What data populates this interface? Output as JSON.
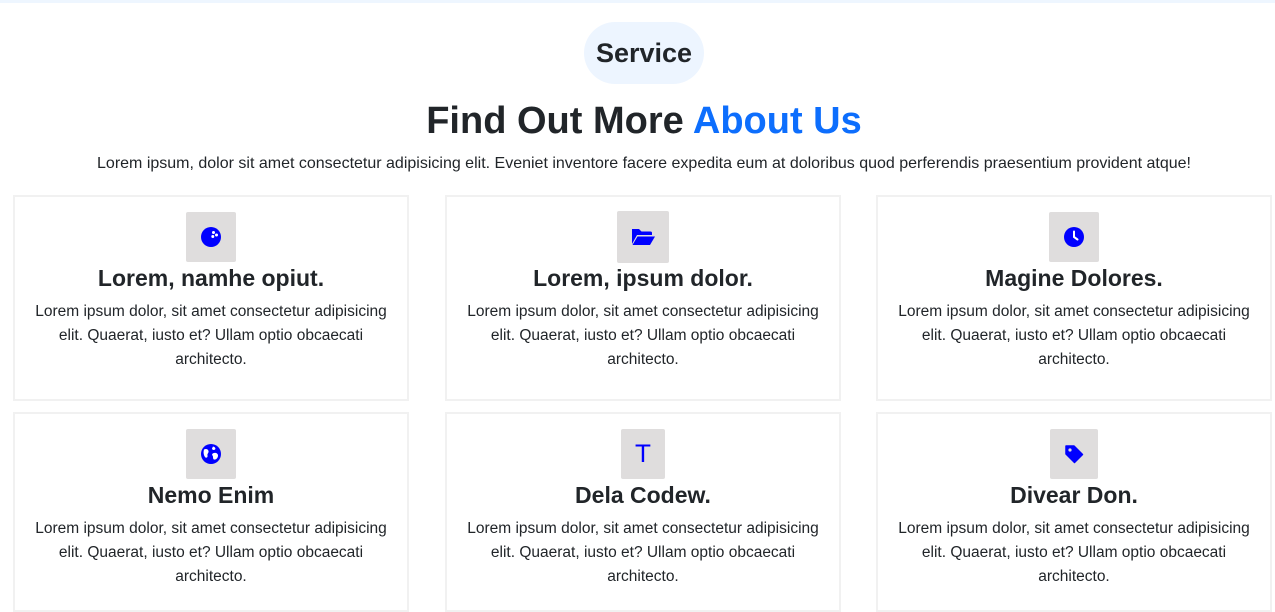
{
  "section": {
    "badge": "Service",
    "heading_main": "Find Out More ",
    "heading_accent": "About Us",
    "subtitle": "Lorem ipsum, dolor sit amet consectetur adipisicing elit. Eveniet inventore facere expedita eum at doloribus quod perferendis praesentium provident atque!"
  },
  "colors": {
    "accent": "#0d6efd",
    "icon": "#0000ff",
    "icon_bg": "#dfdddd",
    "badge_bg": "#edf5ff"
  },
  "cards": [
    {
      "icon": "bowling-ball-icon",
      "title": "Lorem, namhe opiut.",
      "text": "Lorem ipsum dolor, sit amet consectetur adipisicing elit. Quaerat, iusto et? Ullam optio obcaecati architecto."
    },
    {
      "icon": "folder-open-icon",
      "title": "Lorem, ipsum dolor.",
      "text": "Lorem ipsum dolor, sit amet consectetur adipisicing elit. Quaerat, iusto et? Ullam optio obcaecati architecto."
    },
    {
      "icon": "clock-icon",
      "title": "Magine Dolores.",
      "text": "Lorem ipsum dolor, sit amet consectetur adipisicing elit. Quaerat, iusto et? Ullam optio obcaecati architecto."
    },
    {
      "icon": "globe-icon",
      "title": "Nemo Enim",
      "text": "Lorem ipsum dolor, sit amet consectetur adipisicing elit. Quaerat, iusto et? Ullam optio obcaecati architecto."
    },
    {
      "icon": "letter-t-icon",
      "icon_text": "T",
      "title": "Dela Codew.",
      "text": "Lorem ipsum dolor, sit amet consectetur adipisicing elit. Quaerat, iusto et? Ullam optio obcaecati architecto."
    },
    {
      "icon": "tag-icon",
      "title": "Divear Don.",
      "text": "Lorem ipsum dolor, sit amet consectetur adipisicing elit. Quaerat, iusto et? Ullam optio obcaecati architecto."
    }
  ]
}
